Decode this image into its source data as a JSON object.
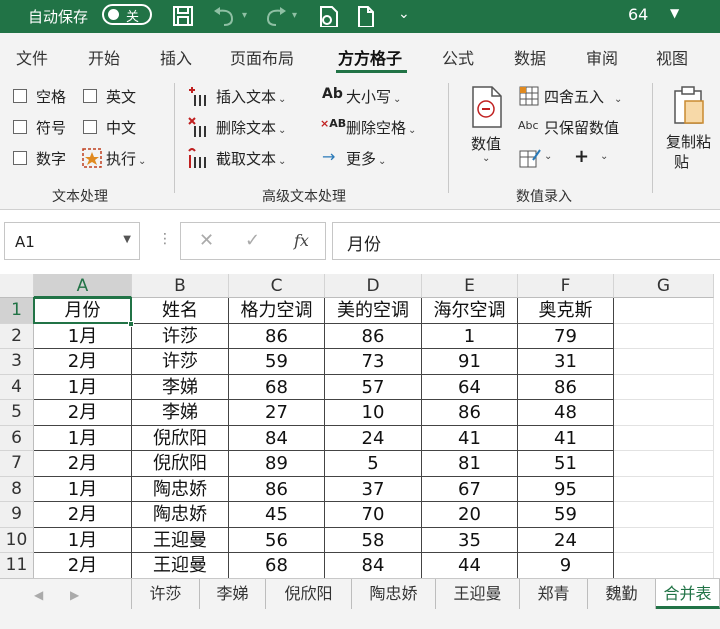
{
  "titlebar": {
    "autosave_label": "自动保存",
    "autosave_state": "关",
    "count": "64",
    "icons": [
      "save-icon",
      "undo-icon",
      "redo-icon",
      "form-icon",
      "new-file-icon",
      "customize-caret-icon"
    ]
  },
  "ribbon_tabs": [
    {
      "label": "文件"
    },
    {
      "label": "开始"
    },
    {
      "label": "插入"
    },
    {
      "label": "页面布局"
    },
    {
      "label": "方方格子",
      "active": true
    },
    {
      "label": "公式"
    },
    {
      "label": "数据"
    },
    {
      "label": "审阅"
    },
    {
      "label": "视图"
    }
  ],
  "ribbon": {
    "text_processing": {
      "checkboxes": [
        "空格",
        "英文",
        "符号",
        "中文",
        "数字"
      ],
      "execute": "执行",
      "label": "文本处理"
    },
    "advanced": {
      "insert_text": "插入文本",
      "delete_text": "删除文本",
      "extract_text": "截取文本",
      "case": "大小写",
      "delete_spaces": "删除空格",
      "more": "更多",
      "label": "高级文本处理"
    },
    "numeric": {
      "value": "数值",
      "round": "四舍五入",
      "keep_values": "只保留数值",
      "plus": "+",
      "label": "数值录入"
    },
    "paste": {
      "line1": "复制粘",
      "line2": "贴"
    }
  },
  "formula_bar": {
    "name_box": "A1",
    "fx": "fx",
    "content": "月份"
  },
  "columns": [
    "A",
    "B",
    "C",
    "D",
    "E",
    "F",
    "G"
  ],
  "rows": [
    "1",
    "2",
    "3",
    "4",
    "5",
    "6",
    "7",
    "8",
    "9",
    "10",
    "11"
  ],
  "table": [
    [
      "月份",
      "姓名",
      "格力空调",
      "美的空调",
      "海尔空调",
      "奥克斯"
    ],
    [
      "1月",
      "许莎",
      "86",
      "86",
      "1",
      "79"
    ],
    [
      "2月",
      "许莎",
      "59",
      "73",
      "91",
      "31"
    ],
    [
      "1月",
      "李娣",
      "68",
      "57",
      "64",
      "86"
    ],
    [
      "2月",
      "李娣",
      "27",
      "10",
      "86",
      "48"
    ],
    [
      "1月",
      "倪欣阳",
      "84",
      "24",
      "41",
      "41"
    ],
    [
      "2月",
      "倪欣阳",
      "89",
      "5",
      "81",
      "51"
    ],
    [
      "1月",
      "陶忠娇",
      "86",
      "37",
      "67",
      "95"
    ],
    [
      "2月",
      "陶忠娇",
      "45",
      "70",
      "20",
      "59"
    ],
    [
      "1月",
      "王迎曼",
      "56",
      "58",
      "35",
      "24"
    ],
    [
      "2月",
      "王迎曼",
      "68",
      "84",
      "44",
      "9"
    ]
  ],
  "sheets": [
    "许莎",
    "李娣",
    "倪欣阳",
    "陶忠娇",
    "王迎曼",
    "郑青",
    "魏勤",
    "合并表"
  ],
  "active_sheet": "合并表",
  "colors": {
    "accent": "#217346",
    "ribbon_bg": "#f3f3f3"
  }
}
